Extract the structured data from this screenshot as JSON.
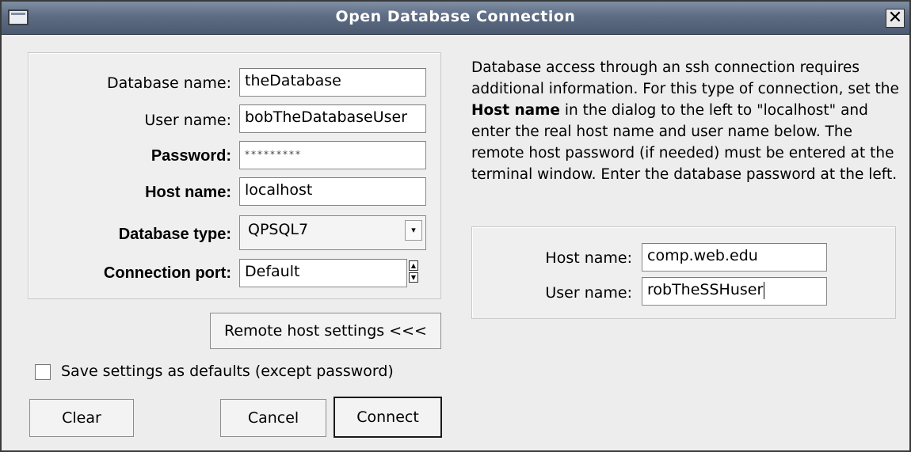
{
  "window": {
    "title": "Open Database Connection",
    "close_glyph": "✕"
  },
  "form": {
    "database_name_label": "Database name:",
    "database_name_value": "theDatabase",
    "user_name_label": "User name:",
    "user_name_value": "bobTheDatabaseUser",
    "password_label": "Password:",
    "password_value": "*********",
    "host_name_label": "Host name:",
    "host_name_value": "localhost",
    "database_type_label": "Database type:",
    "database_type_value": "QPSQL7",
    "connection_port_label": "Connection port:",
    "connection_port_value": "Default"
  },
  "buttons": {
    "remote_host_settings": "Remote host settings <<<",
    "clear": "Clear",
    "cancel": "Cancel",
    "connect": "Connect"
  },
  "save_defaults": {
    "label": "Save settings as defaults (except password)",
    "checked": false
  },
  "ssh_info": {
    "text_before": "Database access through an ssh connection requires additional information. For this type of connection, set the ",
    "bold": "Host name",
    "text_after": " in the dialog to the left to \"localhost\" and enter the real host name and user name below. The remote host password (if needed) must be entered at the terminal window. Enter the database password at the left."
  },
  "ssh": {
    "host_name_label": "Host name:",
    "host_name_value": "comp.web.edu",
    "user_name_label": "User name:",
    "user_name_value": "robTheSSHuser"
  }
}
